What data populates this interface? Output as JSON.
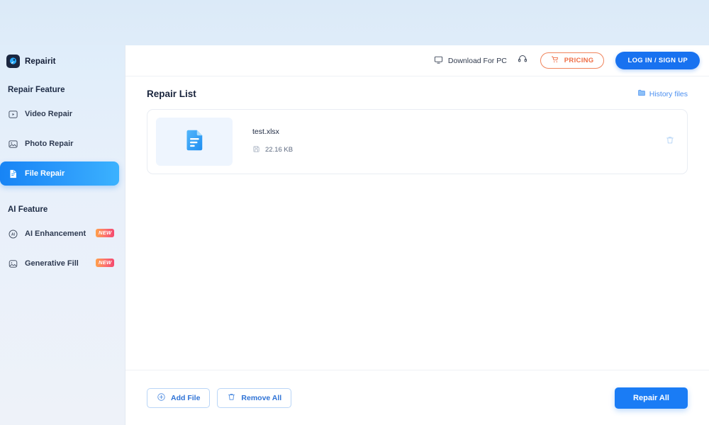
{
  "brand": {
    "name": "Repairit",
    "logo_icon": "repairit-logo-icon"
  },
  "sidebar": {
    "sections": [
      {
        "title": "Repair Feature",
        "items": [
          {
            "label": "Video Repair",
            "icon": "video-repair-icon",
            "active": false,
            "badge": ""
          },
          {
            "label": "Photo Repair",
            "icon": "photo-repair-icon",
            "active": false,
            "badge": ""
          },
          {
            "label": "File Repair",
            "icon": "file-repair-icon",
            "active": true,
            "badge": ""
          }
        ]
      },
      {
        "title": "AI Feature",
        "items": [
          {
            "label": "AI Enhancement",
            "icon": "ai-enhancement-icon",
            "active": false,
            "badge": "NEW"
          },
          {
            "label": "Generative Fill",
            "icon": "generative-fill-icon",
            "active": false,
            "badge": "NEW"
          }
        ]
      }
    ]
  },
  "header": {
    "download_label": "Download For PC",
    "download_icon": "monitor-icon",
    "support_icon": "headset-icon",
    "pricing_label": "PRICING",
    "pricing_icon": "cart-icon",
    "login_label": "LOG IN / SIGN UP"
  },
  "main": {
    "title": "Repair List",
    "history_label": "History files",
    "history_icon": "folder-icon",
    "files": [
      {
        "name": "test.xlsx",
        "size": "22.16 KB",
        "size_icon": "save-disk-icon",
        "thumb_icon": "document-file-icon",
        "delete_icon": "trash-icon"
      }
    ]
  },
  "footer": {
    "add_file_label": "Add File",
    "add_file_icon": "plus-circle-icon",
    "remove_all_label": "Remove All",
    "remove_all_icon": "trash-icon",
    "repair_all_label": "Repair All"
  },
  "colors": {
    "accent_blue": "#1a7cf5",
    "pricing_orange": "#ef6d45",
    "badge_gradient_start": "#ffa14a",
    "badge_gradient_end": "#f4496e",
    "sidebar_top": "#dfedfa",
    "sidebar_bottom": "#eef2f9"
  }
}
